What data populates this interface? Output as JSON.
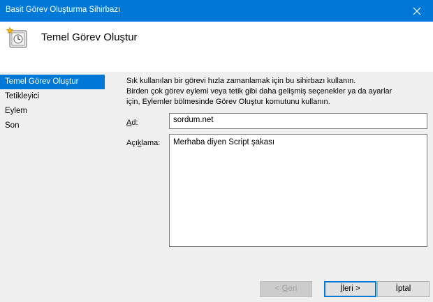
{
  "window": {
    "title": "Basit Görev Oluşturma Sihirbazı",
    "close_icon": "close-icon"
  },
  "header": {
    "icon": "task-clock-icon",
    "heading": "Temel Görev Oluştur"
  },
  "sidebar": {
    "items": [
      {
        "label": "Temel Görev Oluştur",
        "active": true
      },
      {
        "label": "Tetikleyici",
        "active": false
      },
      {
        "label": "Eylem",
        "active": false
      },
      {
        "label": "Son",
        "active": false
      }
    ]
  },
  "main": {
    "intro_lines": [
      "Sık kullanılan bir görevi hızla zamanlamak için bu sihirbazı kullanın.",
      "Birden çok görev eylemi veya tetik gibi daha gelişmiş seçenekler ya da ayarlar",
      "için, Eylemler bölmesinde Görev Oluştur komutunu kullanın."
    ],
    "name_label_mnemonic": "A",
    "name_label_rest": "d:",
    "name_value": "sordum.net",
    "desc_label_pre": "Açı",
    "desc_label_mnemonic": "k",
    "desc_label_post": "lama:",
    "desc_value": "Merhaba diyen Script şakası"
  },
  "buttons": {
    "back_pre": "< ",
    "back_mnemonic": "G",
    "back_post": "eri",
    "next_mnemonic": "İ",
    "next_post": "leri >",
    "cancel": "İptal"
  },
  "colors": {
    "accent": "#0078d7",
    "panel": "#f0f0f0"
  }
}
